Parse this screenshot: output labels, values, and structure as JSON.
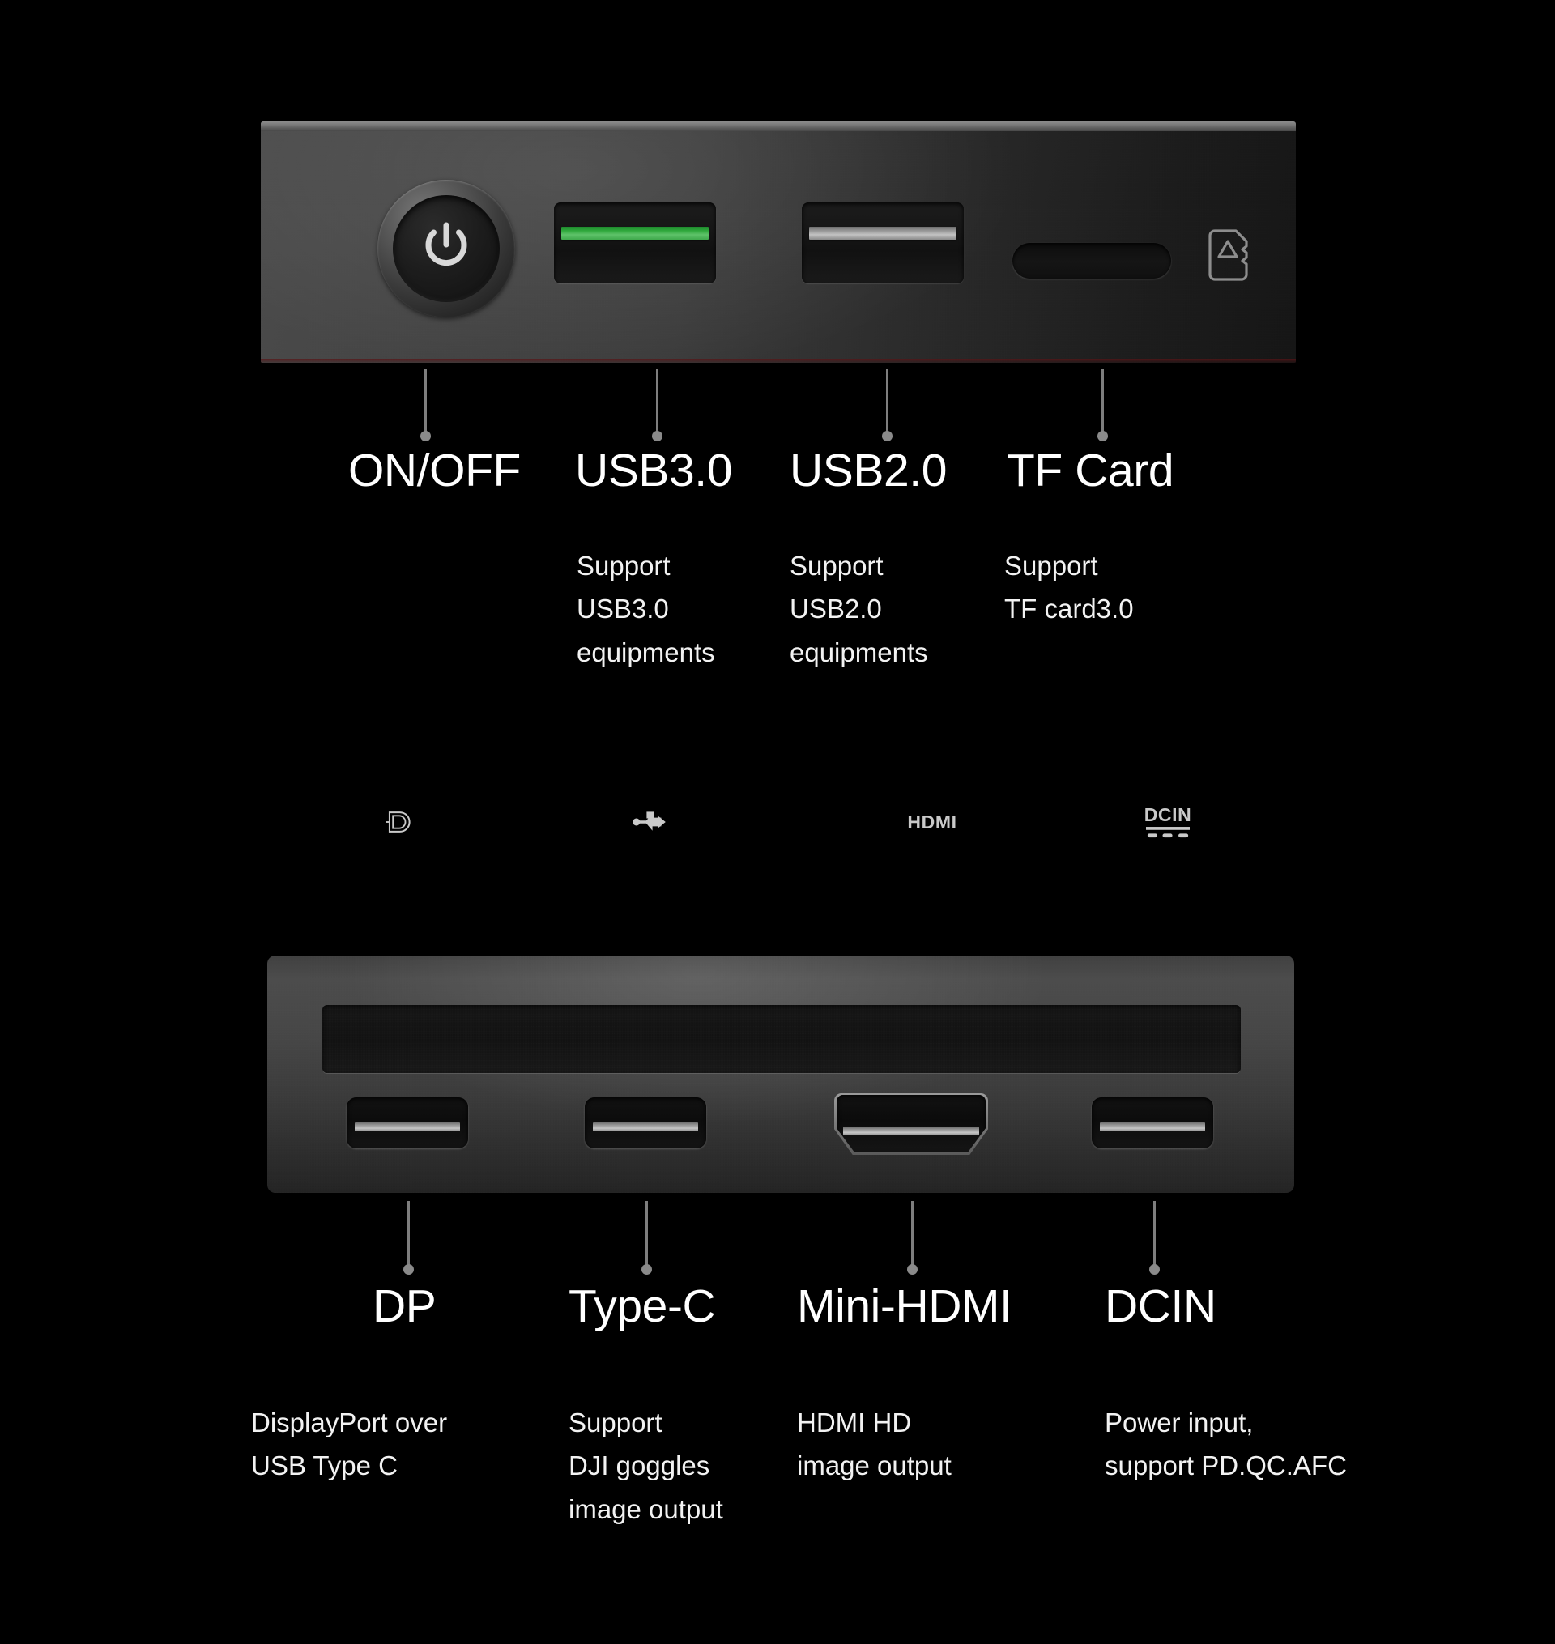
{
  "background_color": "#000000",
  "accent_colors": {
    "usb3_tongue": "#2fa83c",
    "usb2_tongue": "#c3c3c3",
    "label_text": "#ffffff",
    "leader_line": "#7e7e7e",
    "panel_metal": "#434343"
  },
  "top_panel": {
    "name": "front-io-panel",
    "controls": [
      {
        "key": "power",
        "icon": "power-icon",
        "type": "button"
      },
      {
        "key": "usb3",
        "icon": "usb-a-port-green",
        "type": "port"
      },
      {
        "key": "usb2",
        "icon": "usb-a-port-grey",
        "type": "port"
      },
      {
        "key": "tf",
        "icon": "microsd-card-icon",
        "type": "slot"
      }
    ],
    "callouts": [
      {
        "label": "ON/OFF",
        "description": ""
      },
      {
        "label": "USB3.0",
        "description": "Support\nUSB3.0\nequipments"
      },
      {
        "label": "USB2.0",
        "description": "Support\nUSB2.0\nequipments"
      },
      {
        "label": "TF Card",
        "description": "Support\nTF  card3.0"
      }
    ]
  },
  "bottom_panel": {
    "name": "rear-io-panel",
    "strip_marks": [
      {
        "kind": "icon",
        "icon": "displayport-icon",
        "text": ""
      },
      {
        "kind": "icon",
        "icon": "usb-trident-icon",
        "text": ""
      },
      {
        "kind": "text",
        "icon": "hdmi-label",
        "text": "HDMI"
      },
      {
        "kind": "text",
        "icon": "dcin-label",
        "text": "DCIN"
      }
    ],
    "callouts": [
      {
        "label": "DP",
        "description": "DisplayPort over\nUSB Type C"
      },
      {
        "label": "Type-C",
        "description": "Support\nDJI goggles\nimage output"
      },
      {
        "label": "Mini-HDMI",
        "description": "HDMI HD\nimage output"
      },
      {
        "label": "DCIN",
        "description": "Power input,\nsupport PD.QC.AFC"
      }
    ]
  }
}
